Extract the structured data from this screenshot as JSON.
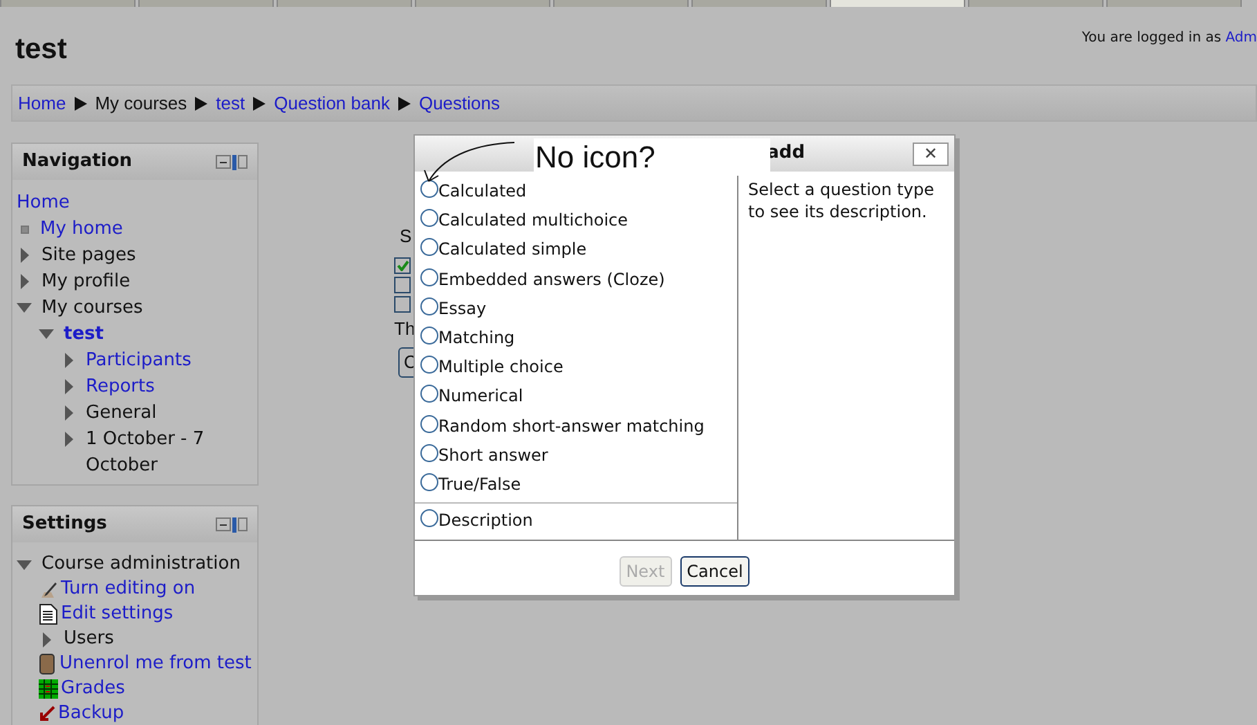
{
  "top_tabs": [
    {
      "selected": false
    },
    {
      "selected": false
    },
    {
      "selected": false
    },
    {
      "selected": false
    },
    {
      "selected": false
    },
    {
      "selected": false
    },
    {
      "selected": true
    },
    {
      "selected": false
    },
    {
      "selected": false
    }
  ],
  "header": {
    "title": "test",
    "login_text": "You are logged in as",
    "login_link": "Adm"
  },
  "breadcrumb": [
    {
      "label": "Home",
      "kind": "link"
    },
    {
      "label": "My courses",
      "kind": "text"
    },
    {
      "label": "test",
      "kind": "link"
    },
    {
      "label": "Question bank",
      "kind": "link"
    },
    {
      "label": "Questions",
      "kind": "link"
    }
  ],
  "navigation": {
    "title": "Navigation",
    "items": [
      {
        "label": "Home",
        "kind": "plain",
        "link": true,
        "current": false
      },
      {
        "label": "My home",
        "kind": "bullet",
        "link": true,
        "current": false
      },
      {
        "label": "Site pages",
        "kind": "branch",
        "link": false,
        "current": false,
        "expanded": false
      },
      {
        "label": "My profile",
        "kind": "branch",
        "link": false,
        "current": false,
        "expanded": false
      },
      {
        "label": "My courses",
        "kind": "branch",
        "link": false,
        "current": false,
        "expanded": true,
        "children": [
          {
            "label": "test",
            "kind": "branch",
            "link": true,
            "current": true,
            "expanded": true,
            "children": [
              {
                "label": "Participants",
                "kind": "branch",
                "link": true,
                "current": false,
                "expanded": false
              },
              {
                "label": "Reports",
                "kind": "branch",
                "link": true,
                "current": false,
                "expanded": false
              },
              {
                "label": "General",
                "kind": "branch",
                "link": false,
                "current": false,
                "expanded": false
              },
              {
                "label": "1 October - 7 October",
                "kind": "branch",
                "link": false,
                "current": false,
                "expanded": false
              }
            ]
          }
        ]
      }
    ]
  },
  "settings": {
    "title": "Settings",
    "items": [
      {
        "label": "Course administration",
        "kind": "branch",
        "link": false,
        "current": false,
        "expanded": true,
        "children": [
          {
            "label": "Turn editing on",
            "kind": "pencil",
            "link": true,
            "current": false
          },
          {
            "label": "Edit settings",
            "kind": "document",
            "link": true,
            "current": false
          },
          {
            "label": "Users",
            "kind": "branch",
            "link": false,
            "current": false,
            "expanded": false
          },
          {
            "label": "Unenrol me from test",
            "kind": "person",
            "link": true,
            "current": false
          },
          {
            "label": "Grades",
            "kind": "grid",
            "link": true,
            "current": false
          },
          {
            "label": "Backup",
            "kind": "backup",
            "link": true,
            "current": false
          }
        ]
      }
    ]
  },
  "background_form": {
    "heading": "S",
    "checkboxes": [
      {
        "checked": true
      },
      {
        "checked": false
      },
      {
        "checked": false
      }
    ],
    "note": "Th",
    "button": "C"
  },
  "dialog": {
    "title": "add",
    "close": "✕",
    "options": [
      {
        "label": "Calculated",
        "selected": false
      },
      {
        "label": "Calculated multichoice",
        "selected": false
      },
      {
        "label": "Calculated simple",
        "selected": false
      },
      {
        "label": "Embedded answers (Cloze)",
        "selected": false
      },
      {
        "label": "Essay",
        "selected": false
      },
      {
        "label": "Matching",
        "selected": false
      },
      {
        "label": "Multiple choice",
        "selected": false
      },
      {
        "label": "Numerical",
        "selected": false
      },
      {
        "label": "Random short-answer matching",
        "selected": false
      },
      {
        "label": "Short answer",
        "selected": false
      },
      {
        "label": "True/False",
        "selected": false
      }
    ],
    "other_options": [
      {
        "label": "Description",
        "selected": false
      }
    ],
    "description": "Select a question type to see its description.",
    "buttons": [
      {
        "label": "Next",
        "disabled": true
      },
      {
        "label": "Cancel",
        "disabled": false
      }
    ]
  },
  "annotation": {
    "text": "No icon?"
  }
}
